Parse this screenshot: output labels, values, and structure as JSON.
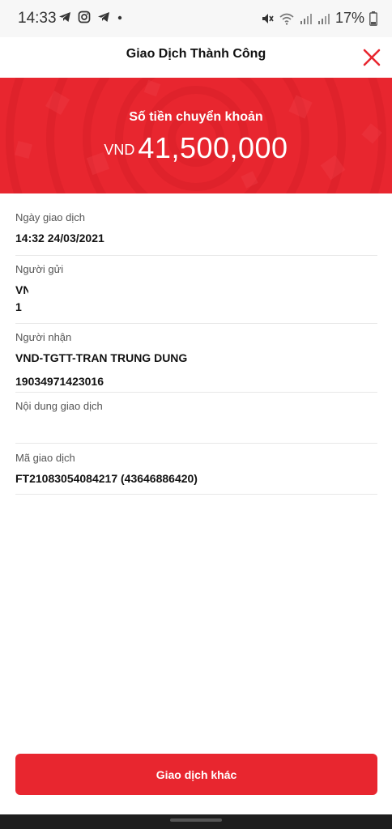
{
  "status_bar": {
    "time": "14:33",
    "left_icons": [
      "telegram-icon",
      "instagram-icon",
      "telegram-icon",
      "dot-icon"
    ],
    "right_icons": [
      "mute-icon",
      "wifi-icon",
      "signal-icon",
      "signal-icon"
    ],
    "battery": "17%"
  },
  "header": {
    "title": "Giao Dịch Thành Công",
    "close_icon": "close-icon"
  },
  "banner": {
    "label": "Số tiền chuyển khoản",
    "currency": "VND",
    "amount": "41,500,000"
  },
  "details": {
    "date_label": "Ngày giao dịch",
    "date_value": "14:32 24/03/2021",
    "sender_label": "Người gửi",
    "sender_value_line1": "VN",
    "sender_value_line2": "1",
    "recipient_label": "Người nhận",
    "recipient_name": "VND-TGTT-TRAN TRUNG DUNG",
    "recipient_account": "19034971423016",
    "content_label": "Nội dung giao dịch",
    "content_value": "",
    "txid_label": "Mã giao dịch",
    "txid_value": "FT21083054084217 (43646886420)"
  },
  "actions": {
    "primary_label": "Giao dịch khác"
  },
  "colors": {
    "brand_red": "#e8262f",
    "background": "#ffffff"
  }
}
